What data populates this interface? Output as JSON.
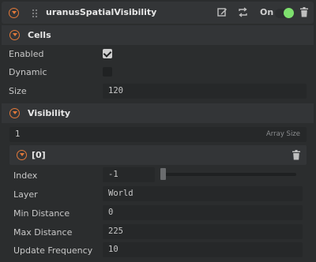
{
  "header": {
    "title": "uranusSpatialVisibility",
    "on_label": "On",
    "enabled": true
  },
  "cells": {
    "title": "Cells",
    "enabled_label": "Enabled",
    "enabled_checked": true,
    "dynamic_label": "Dynamic",
    "dynamic_checked": false,
    "size_label": "Size",
    "size_value": "120"
  },
  "visibility": {
    "title": "Visibility",
    "array_size_value": "1",
    "array_size_label": "Array Size",
    "item": {
      "title": "[0]",
      "index_label": "Index",
      "index_value": "-1",
      "layer_label": "Layer",
      "layer_value": "World",
      "min_distance_label": "Min Distance",
      "min_distance_value": "0",
      "max_distance_label": "Max Distance",
      "max_distance_value": "225",
      "update_frequency_label": "Update Frequency",
      "update_frequency_value": "10"
    }
  },
  "colors": {
    "accent": "#e2793a",
    "toggle_on": "#7ee06e",
    "background": "#2b2d2e",
    "header": "#333537",
    "field": "#262829"
  },
  "icons": {
    "collapse": "chevron-down-circle-icon",
    "drag": "drag-handle-icon",
    "edit": "edit-icon",
    "swap": "swap-icon",
    "delete": "trash-icon"
  }
}
